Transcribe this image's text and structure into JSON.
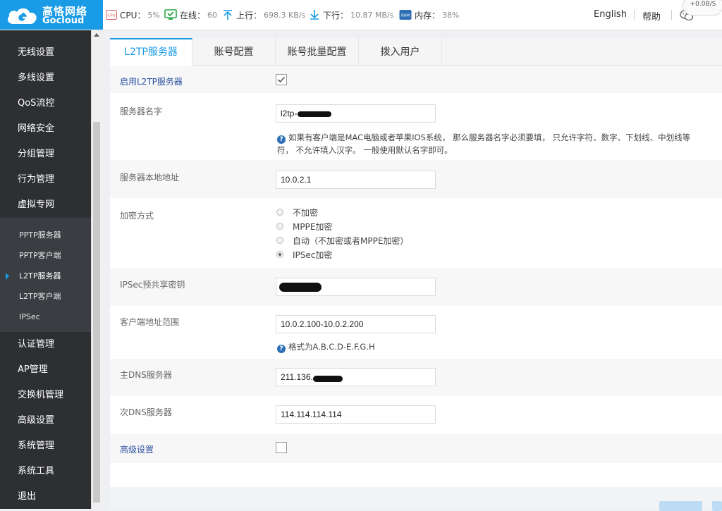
{
  "brand": {
    "name_cn": "高恪网络",
    "name_en": "Gocloud",
    "color": "#1a9be6"
  },
  "status": {
    "cpu_label": "CPU：",
    "cpu_value": "5%",
    "online_label": "在线：",
    "online_value": "60",
    "up_label": "上行：",
    "up_value": "698.3 KB/s",
    "down_label": "下行：",
    "down_value": "10.87 MB/s",
    "mem_label": "内存：",
    "mem_value": "38%",
    "speed_badge": "+0.0B/S"
  },
  "header_links": {
    "language": "English",
    "help": "帮助"
  },
  "sidebar": {
    "items": [
      {
        "label": "无线设置"
      },
      {
        "label": "多线设置"
      },
      {
        "label": "QoS流控"
      },
      {
        "label": "网络安全"
      },
      {
        "label": "分组管理"
      },
      {
        "label": "行为管理"
      },
      {
        "label": "虚拟专网"
      }
    ],
    "submenu": [
      {
        "label": "PPTP服务器"
      },
      {
        "label": "PPTP客户端"
      },
      {
        "label": "L2TP服务器"
      },
      {
        "label": "L2TP客户端"
      },
      {
        "label": "IPSec"
      }
    ],
    "items_after": [
      {
        "label": "认证管理"
      },
      {
        "label": "AP管理"
      },
      {
        "label": "交换机管理"
      },
      {
        "label": "高级设置"
      },
      {
        "label": "系统管理"
      },
      {
        "label": "系统工具"
      },
      {
        "label": "退出"
      }
    ]
  },
  "tabs": [
    {
      "label": "L2TP服务器"
    },
    {
      "label": "账号配置"
    },
    {
      "label": "账号批量配置"
    },
    {
      "label": "拨入用户"
    }
  ],
  "form": {
    "enable_label": "启用L2TP服务器",
    "server_name_label": "服务器名字",
    "server_name_value": "l2tp-",
    "server_name_hint_line1": "如果有客户端是MAC电脑或者苹果IOS系统， 那么服务器名字必须要填， 只允许字符、数字、下划线、中划线等",
    "server_name_hint_line2": "符， 不允许填入汉字。 一般使用默认名字即可。",
    "local_addr_label": "服务器本地地址",
    "local_addr_value": "10.0.2.1",
    "encryption_label": "加密方式",
    "encryption_options": [
      {
        "label": "不加密"
      },
      {
        "label": "MPPE加密"
      },
      {
        "label": "自动（不加密或者MPPE加密）"
      },
      {
        "label": "IPSec加密"
      }
    ],
    "psk_label": "IPSec预共享密钥",
    "range_label": "客户端地址范围",
    "range_value": "10.0.2.100-10.0.2.200",
    "range_hint": "格式为A.B.C.D-E.F.G.H",
    "dns1_label": "主DNS服务器",
    "dns1_value": "211.136.",
    "dns2_label": "次DNS服务器",
    "dns2_value": "114.114.114.114",
    "advanced_label": "高级设置"
  }
}
